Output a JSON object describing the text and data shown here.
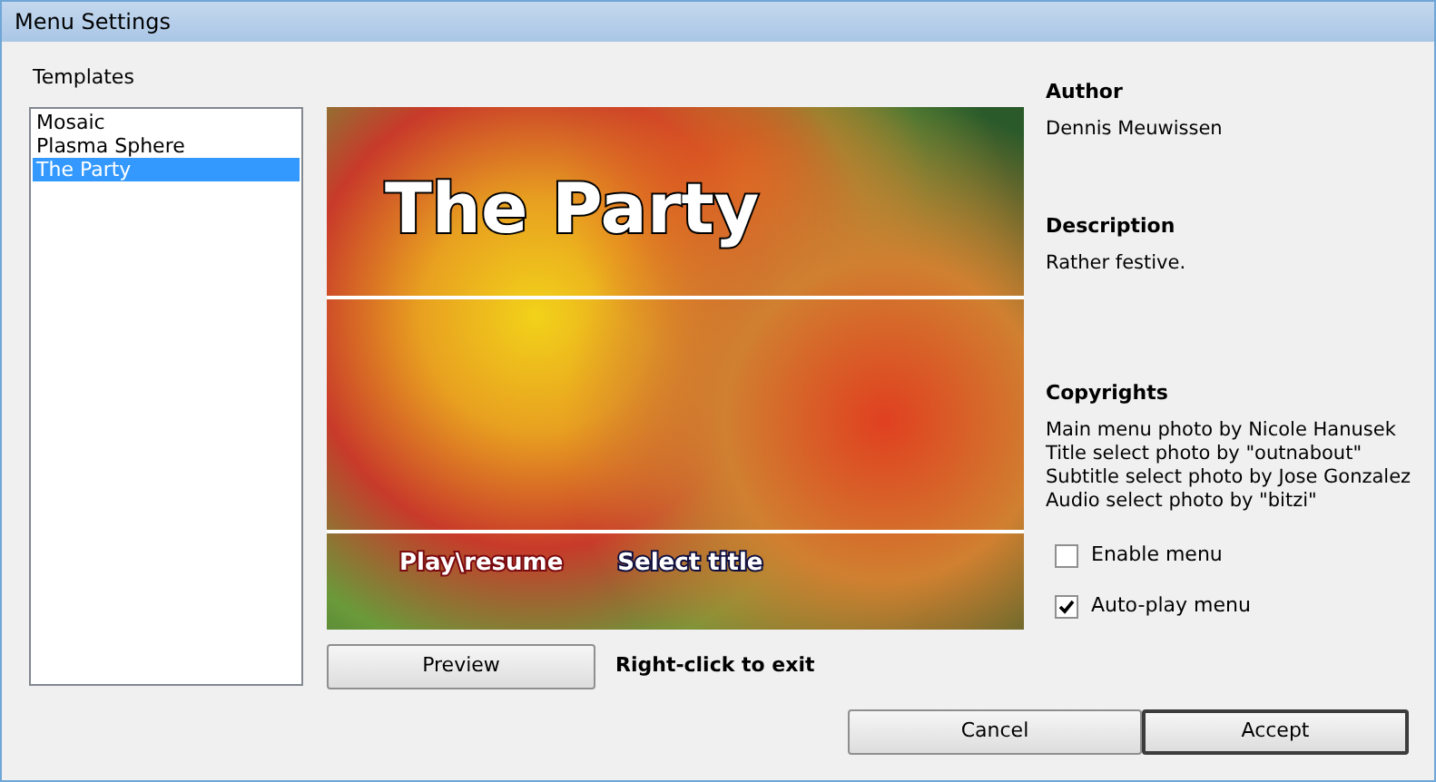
{
  "window": {
    "title": "Menu Settings"
  },
  "templates": {
    "label": "Templates",
    "items": [
      {
        "label": "Mosaic",
        "selected": false
      },
      {
        "label": "Plasma Sphere",
        "selected": false
      },
      {
        "label": "The Party",
        "selected": true
      }
    ]
  },
  "preview": {
    "title": "The Party",
    "menu_items": [
      {
        "label": "Play\\resume",
        "kind": "play"
      },
      {
        "label": "Select title",
        "kind": "select"
      }
    ]
  },
  "preview_button": "Preview",
  "hint": "Right-click to exit",
  "info": [
    {
      "heading": "Author",
      "lines": [
        "Dennis Meuwissen"
      ]
    },
    {
      "heading": "Description",
      "lines": [
        "Rather festive."
      ]
    },
    {
      "heading": "Copyrights",
      "lines": [
        "Main menu photo by Nicole Hanusek",
        "Title select photo by \"outnabout\"",
        "Subtitle select photo by Jose Gonzalez",
        "Audio select photo by \"bitzi\""
      ]
    }
  ],
  "options": [
    {
      "label": "Enable menu",
      "checked": false
    },
    {
      "label": "Auto-play menu",
      "checked": true
    }
  ],
  "buttons": [
    {
      "label": "Cancel",
      "default": false
    },
    {
      "label": "Accept",
      "default": true
    }
  ]
}
